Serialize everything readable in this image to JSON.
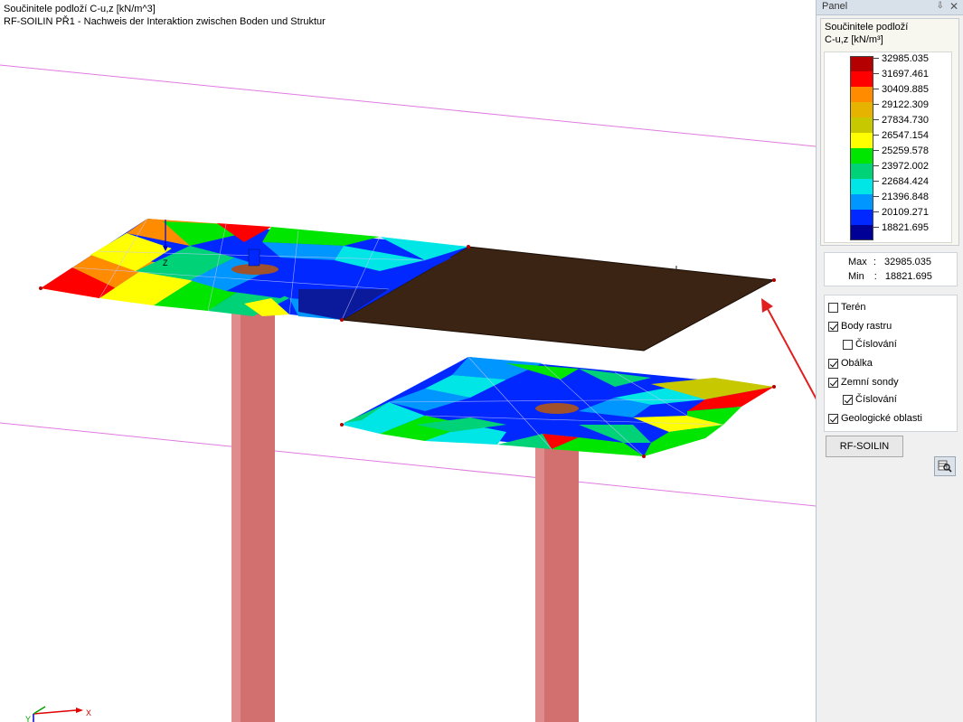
{
  "viewport": {
    "title_line1": "Součinitele podloží C-u,z [kN/m^3]",
    "title_line2": "RF-SOILIN PŘ1 - Nachweis der Interaktion zwischen Boden und Struktur",
    "axis_x_label": "X",
    "axis_y_label": "Y",
    "axis_z_label": "Z"
  },
  "panel": {
    "title": "Panel",
    "pin_icon": "pin-icon",
    "close_icon": "close-icon",
    "legend": {
      "title": "Součinitele podloží",
      "subtitle": "C-u,z [kN/m³]",
      "levels": [
        {
          "value": "32985.035",
          "color": "#b40000"
        },
        {
          "value": "31697.461",
          "color": "#ff0000"
        },
        {
          "value": "30409.885",
          "color": "#ff8c00"
        },
        {
          "value": "29122.309",
          "color": "#e6b400"
        },
        {
          "value": "27834.730",
          "color": "#c8c800"
        },
        {
          "value": "26547.154",
          "color": "#ffff00"
        },
        {
          "value": "25259.578",
          "color": "#00e600"
        },
        {
          "value": "23972.002",
          "color": "#00d278"
        },
        {
          "value": "22684.424",
          "color": "#00e6e6"
        },
        {
          "value": "21396.848",
          "color": "#0096ff"
        },
        {
          "value": "20109.271",
          "color": "#0028ff"
        },
        {
          "value": "18821.695",
          "color": "#000096"
        }
      ]
    },
    "max_label": "Max",
    "max_value": "32985.035",
    "min_label": "Min",
    "min_value": "18821.695",
    "options": [
      {
        "label": "Terén",
        "checked": false
      },
      {
        "label": "Body rastru",
        "checked": true
      },
      {
        "label": "Číslování",
        "checked": false
      },
      {
        "label": "Obálka",
        "checked": true
      },
      {
        "label": "Zemní sondy",
        "checked": true
      },
      {
        "label": "Číslování",
        "checked": true
      },
      {
        "label": "Geologické oblasti",
        "checked": true
      }
    ],
    "button_label": "RF-SOILIN",
    "tool_icon": "zoom-table-icon"
  },
  "colors": {
    "highlight": "#e02020",
    "column": "#d27070",
    "geo_area": "#3c2414",
    "guide_line": "#e070e0"
  }
}
